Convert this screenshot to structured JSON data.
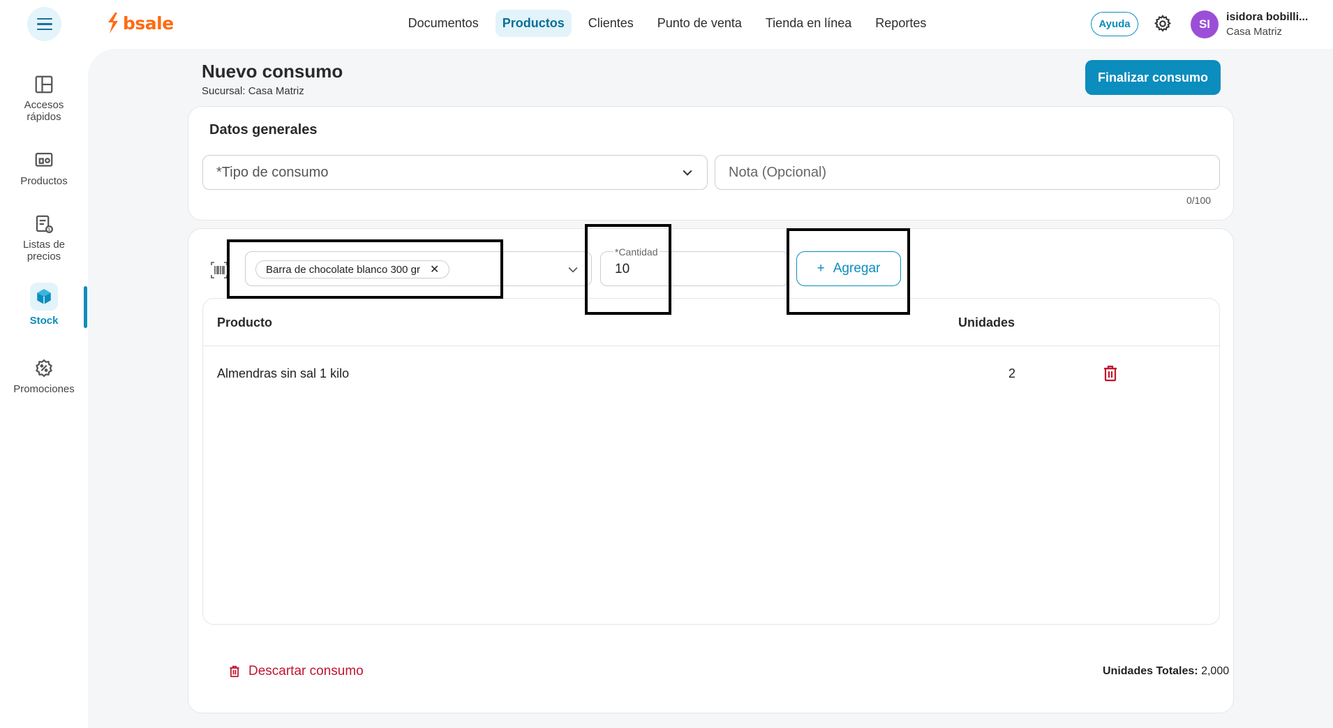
{
  "header": {
    "brand": "bsale",
    "nav": [
      {
        "label": "Documentos",
        "active": false
      },
      {
        "label": "Productos",
        "active": true
      },
      {
        "label": "Clientes",
        "active": false
      },
      {
        "label": "Punto de venta",
        "active": false
      },
      {
        "label": "Tienda en línea",
        "active": false
      },
      {
        "label": "Reportes",
        "active": false
      }
    ],
    "help_label": "Ayuda",
    "avatar_initials": "SI",
    "user_name": "isidora bobilli...",
    "user_branch": "Casa Matriz"
  },
  "sidebar": {
    "items": [
      {
        "label": "Accesos\nrápidos",
        "icon": "layout-icon"
      },
      {
        "label": "Productos",
        "icon": "products-icon"
      },
      {
        "label": "Listas de\nprecios",
        "icon": "price-list-icon"
      },
      {
        "label": "Stock",
        "icon": "cube-icon",
        "active": true
      },
      {
        "label": "Promociones",
        "icon": "discount-icon"
      }
    ]
  },
  "page": {
    "title": "Nuevo consumo",
    "subtitle": "Sucursal: Casa Matriz",
    "finalize_label": "Finalizar consumo"
  },
  "general": {
    "title": "Datos generales",
    "tipo_placeholder": "*Tipo de consumo",
    "nota_placeholder": "Nota (Opcional)",
    "nota_counter": "0/100"
  },
  "entry": {
    "product_chip": "Barra de chocolate blanco 300 gr",
    "qty_label": "*Cantidad",
    "qty_value": "10",
    "add_label": "Agregar"
  },
  "table": {
    "headers": {
      "product": "Producto",
      "units": "Unidades"
    },
    "rows": [
      {
        "product": "Almendras sin sal 1 kilo",
        "units": "2"
      }
    ]
  },
  "footer": {
    "discard_label": "Descartar consumo",
    "totals_label": "Unidades Totales:",
    "totals_value": "2,000"
  },
  "colors": {
    "accent": "#0b8dbd",
    "brand": "#ff6a13",
    "danger": "#c0152f",
    "avatar": "#9b4fd6"
  }
}
